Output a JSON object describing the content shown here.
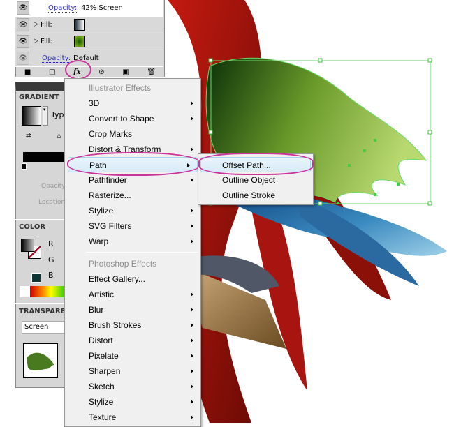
{
  "appearance": {
    "rows": [
      {
        "label": "Opacity:",
        "value": "42% Screen"
      },
      {
        "label": "Fill:"
      },
      {
        "label": "Fill:"
      },
      {
        "label": "Opacity:",
        "value": "Default"
      }
    ],
    "fx_label": "fx"
  },
  "gradient": {
    "title": "GRADIENT",
    "type_label": "Typ",
    "opacity_label": "Opacity",
    "location_label": "Location"
  },
  "color": {
    "title": "COLOR",
    "r": "R",
    "g": "G",
    "b": "B"
  },
  "transparency": {
    "title": "TRANSPARE",
    "blend_mode": "Screen"
  },
  "menu": {
    "items": [
      {
        "label": "Illustrator Effects",
        "disabled": true
      },
      {
        "label": "3D",
        "sub": true
      },
      {
        "label": "Convert to Shape",
        "sub": true
      },
      {
        "label": "Crop Marks"
      },
      {
        "label": "Distort & Transform",
        "sub": true
      },
      {
        "label": "Path",
        "sub": true,
        "active": true
      },
      {
        "label": "Pathfinder",
        "sub": true
      },
      {
        "label": "Rasterize..."
      },
      {
        "label": "Stylize",
        "sub": true
      },
      {
        "label": "SVG Filters",
        "sub": true
      },
      {
        "label": "Warp",
        "sub": true
      },
      {
        "label": "Photoshop Effects",
        "disabled": true
      },
      {
        "label": "Effect Gallery..."
      },
      {
        "label": "Artistic",
        "sub": true
      },
      {
        "label": "Blur",
        "sub": true
      },
      {
        "label": "Brush Strokes",
        "sub": true
      },
      {
        "label": "Distort",
        "sub": true
      },
      {
        "label": "Pixelate",
        "sub": true
      },
      {
        "label": "Sharpen",
        "sub": true
      },
      {
        "label": "Sketch",
        "sub": true
      },
      {
        "label": "Stylize",
        "sub": true
      },
      {
        "label": "Texture",
        "sub": true
      }
    ]
  },
  "submenu": {
    "items": [
      "Offset Path...",
      "Outline Object",
      "Outline Stroke"
    ]
  },
  "colors": {
    "highlight": "#d7ebf7",
    "annotation": "#cc3399",
    "selection": "#66dd66"
  }
}
